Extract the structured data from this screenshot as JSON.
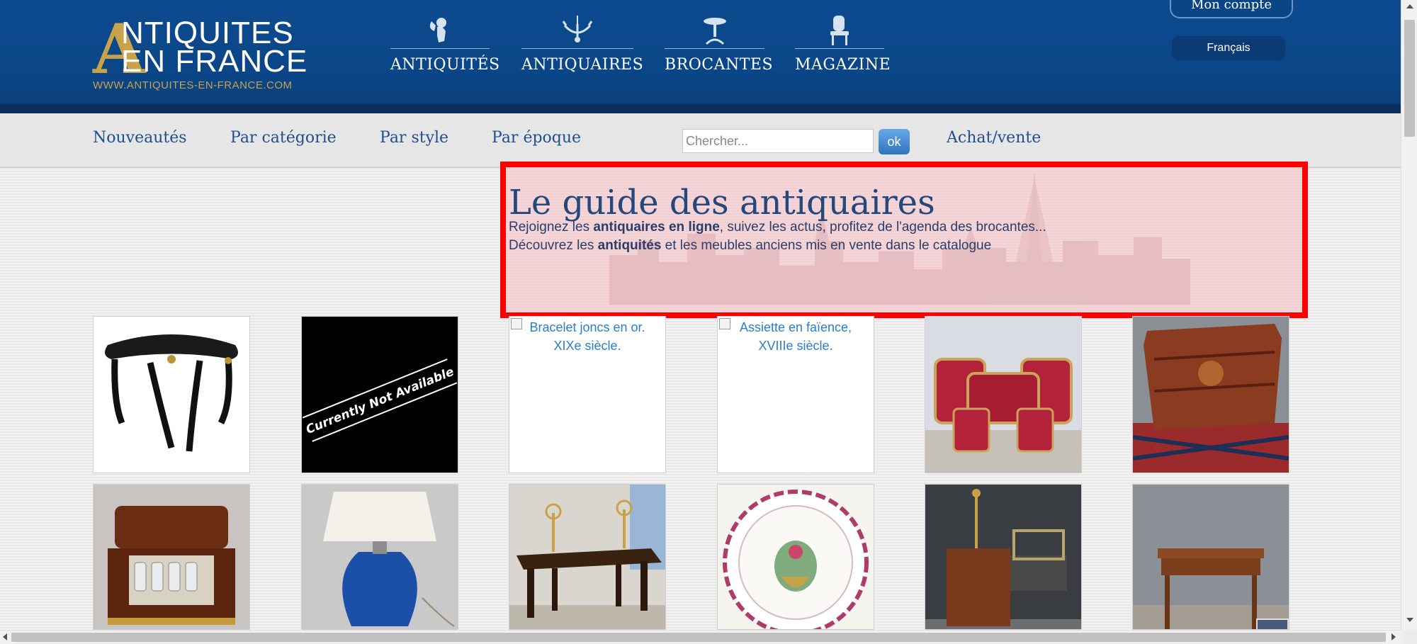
{
  "header": {
    "logo": {
      "big_letter": "A",
      "line1": "NTIQUITES",
      "line2": "EN FRANCE",
      "url": "WWW.ANTIQUITES-EN-FRANCE.COM"
    },
    "nav": [
      {
        "label": "ANTIQUITÉS",
        "icon": "cherub-icon"
      },
      {
        "label": "ANTIQUAIRES",
        "icon": "chandelier-icon"
      },
      {
        "label": "BROCANTES",
        "icon": "table-icon"
      },
      {
        "label": "MAGAZINE",
        "icon": "chair-icon"
      }
    ],
    "account_label": "Mon compte",
    "language": "Français"
  },
  "subnav": {
    "items": [
      "Nouveautés",
      "Par catégorie",
      "Par style",
      "Par époque"
    ],
    "search_placeholder": "Chercher...",
    "search_button": "ok",
    "achat_vente": "Achat/vente"
  },
  "hero": {
    "title": "Le guide des antiquaires",
    "line1_pre": "Rejoignez les ",
    "line1_bold": "antiquaires en ligne",
    "line1_post": ", suivez les actus, profitez de l'agenda des brocantes...",
    "line2_pre": "Découvrez les ",
    "line2_bold": "antiquités",
    "line2_post": " et les meubles anciens mis en vente dans le catalogue",
    "highlight_color": "#ff0000"
  },
  "products": [
    {
      "alt": "",
      "kind": "black-table"
    },
    {
      "alt": "",
      "kind": "not-available",
      "overlay_text": "Currently Not Available"
    },
    {
      "alt": "Bracelet joncs en or. XIXe siècle.",
      "kind": "broken"
    },
    {
      "alt": "Assiette en faïence, XVIIIe siècle.",
      "kind": "broken"
    },
    {
      "alt": "",
      "kind": "red-salon"
    },
    {
      "alt": "",
      "kind": "commode"
    },
    {
      "alt": "",
      "kind": "cave-liqueur"
    },
    {
      "alt": "",
      "kind": "blue-lamp"
    },
    {
      "alt": "",
      "kind": "oak-table"
    },
    {
      "alt": "",
      "kind": "faience-plate"
    },
    {
      "alt": "",
      "kind": "desk-gray"
    },
    {
      "alt": "",
      "kind": "side-table"
    }
  ]
}
